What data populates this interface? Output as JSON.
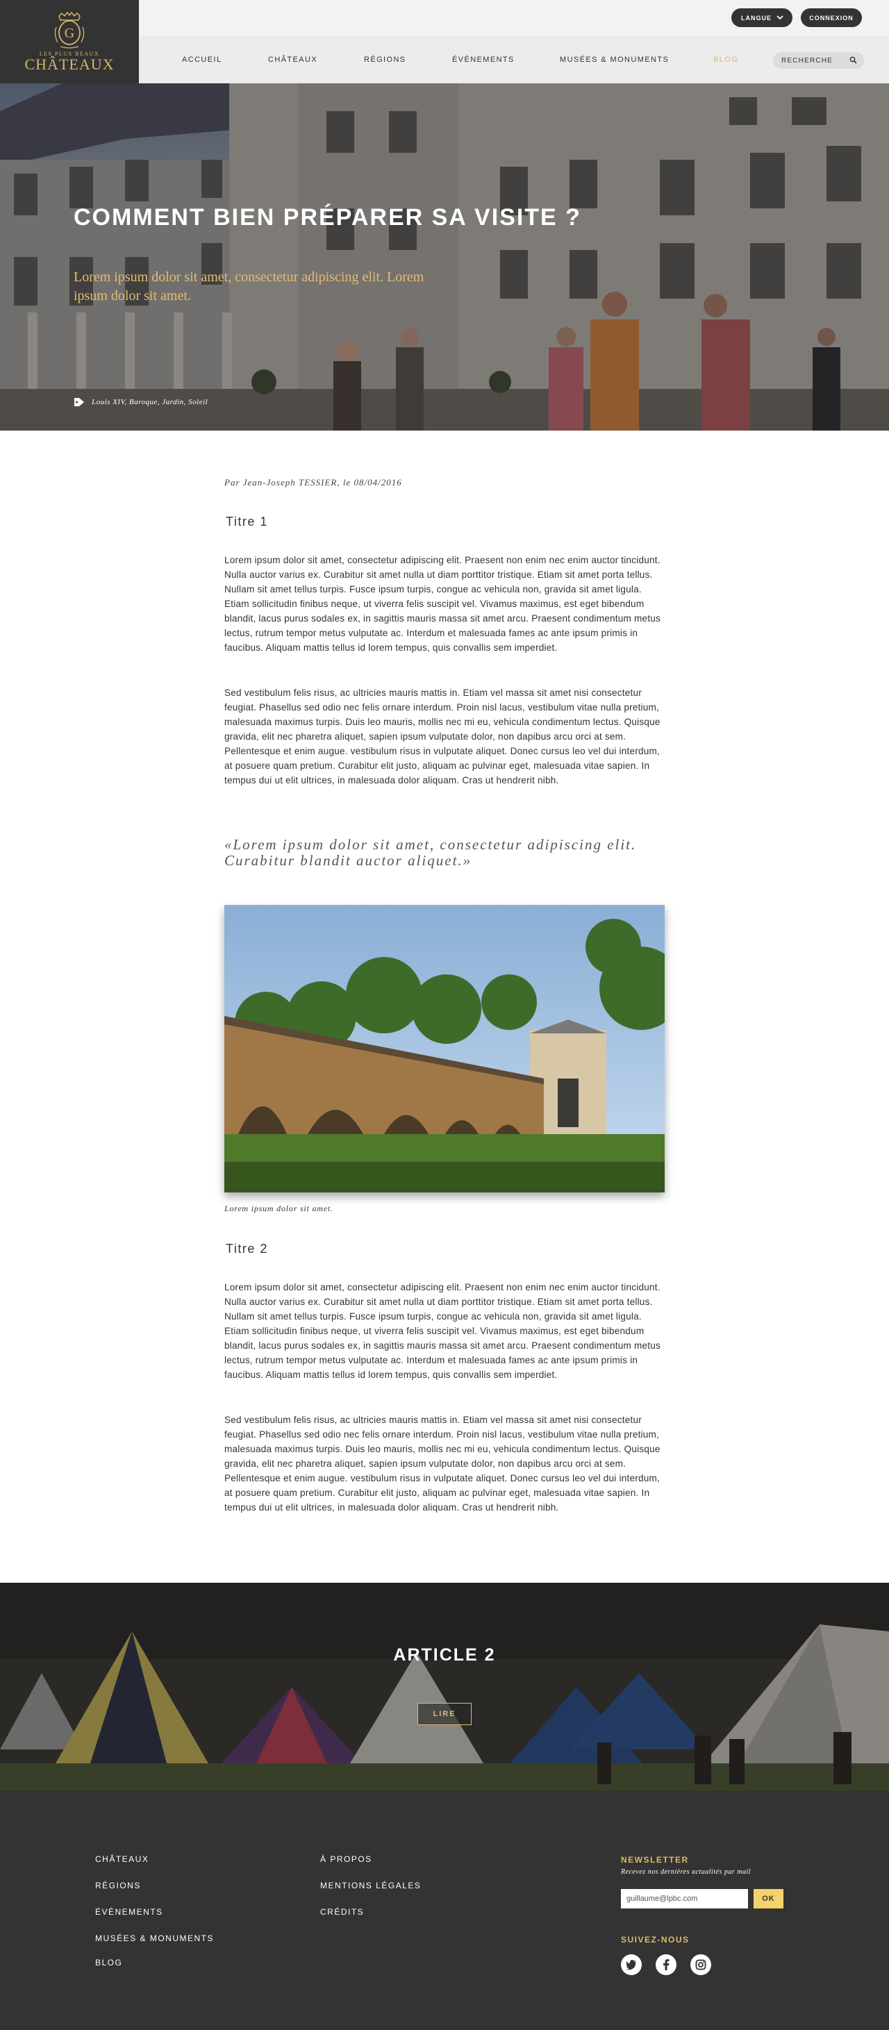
{
  "brand": {
    "logo_small": "LES PLUS BEAUX",
    "logo_big": "CHÂTEAUX",
    "gold": "#e0b96a",
    "dark": "#333333"
  },
  "topbar": {
    "language_label": "LANGUE",
    "login_label": "CONNEXION"
  },
  "nav": {
    "items": [
      "ACCUEIL",
      "CHÂTEAUX",
      "RÉGIONS",
      "ÉVÉNEMENTS",
      "MUSÉES & MONUMENTS",
      "BLOG"
    ],
    "search_label": "RECHERCHE"
  },
  "hero": {
    "title": "COMMENT BIEN PRÉPARER SA VISITE ?",
    "subtitle": "Lorem ipsum dolor sit amet, consectetur adipiscing elit. Lorem ipsum dolor sit amet.",
    "tags": "Louis XIV, Baroque, Jardin, Soleil"
  },
  "article": {
    "byline": "Par Jean-Joseph TESSIER, le 08/04/2016",
    "heading1": "Titre 1",
    "p1": "Lorem ipsum dolor sit amet, consectetur adipiscing elit. Praesent non enim nec enim auctor tincidunt. Nulla auctor varius ex. Curabitur sit amet nulla ut diam porttitor tristique. Etiam sit amet porta tellus. Nullam sit amet tellus turpis. Fusce ipsum turpis, congue ac vehicula non, gravida sit amet ligula. Etiam sollicitudin finibus neque, ut viverra felis suscipit vel. Vivamus maximus, est eget bibendum blandit, lacus purus sodales ex, in sagittis mauris massa sit amet arcu. Praesent condimentum metus lectus, rutrum tempor metus vulputate ac. Interdum et malesuada fames ac ante ipsum primis in faucibus. Aliquam mattis tellus id lorem tempus, quis convallis sem imperdiet.",
    "p2": "Sed vestibulum felis risus, ac ultricies mauris mattis in. Etiam vel massa sit amet nisi consectetur feugiat. Phasellus sed odio nec felis ornare interdum. Proin nisl lacus, vestibulum vitae nulla pretium, malesuada maximus turpis. Duis leo mauris, mollis nec mi eu, vehicula condimentum lectus. Quisque gravida, elit nec pharetra aliquet, sapien ipsum vulputate dolor, non dapibus arcu orci at sem. Pellentesque et enim augue. vestibulum risus in vulputate aliquet. Donec cursus leo vel dui interdum, at posuere quam pretium. Curabitur elit justo, aliquam ac pulvinar eget, malesuada vitae sapien. In tempus dui ut elit ultrices, in malesuada dolor aliquam. Cras ut hendrerit nibh.",
    "quote": "«Lorem ipsum dolor sit amet, consectetur adipiscing elit. Curabitur blandit auctor aliquet.»",
    "caption": "Lorem ipsum dolor sit amet.",
    "heading2": "Titre 2",
    "p3": "Lorem ipsum dolor sit amet, consectetur adipiscing elit. Praesent non enim nec enim auctor tincidunt. Nulla auctor varius ex. Curabitur sit amet nulla ut diam porttitor tristique. Etiam sit amet porta tellus. Nullam sit amet tellus turpis. Fusce ipsum turpis, congue ac vehicula non, gravida sit amet ligula. Etiam sollicitudin finibus neque, ut viverra felis suscipit vel. Vivamus maximus, est eget bibendum blandit, lacus purus sodales ex, in sagittis mauris massa sit amet arcu. Praesent condimentum metus lectus, rutrum tempor metus vulputate ac. Interdum et malesuada fames ac ante ipsum primis in faucibus. Aliquam mattis tellus id lorem tempus, quis convallis sem imperdiet.",
    "p4": "Sed vestibulum felis risus, ac ultricies mauris mattis in. Etiam vel massa sit amet nisi consectetur feugiat. Phasellus sed odio nec felis ornare interdum. Proin nisl lacus, vestibulum vitae nulla pretium, malesuada maximus turpis. Duis leo mauris, mollis nec mi eu, vehicula condimentum lectus. Quisque gravida, elit nec pharetra aliquet, sapien ipsum vulputate dolor, non dapibus arcu orci at sem. Pellentesque et enim augue. vestibulum risus in vulputate aliquet. Donec cursus leo vel dui interdum, at posuere quam pretium. Curabitur elit justo, aliquam ac pulvinar eget, malesuada vitae sapien. In tempus dui ut elit ultrices, in malesuada dolor aliquam. Cras ut hendrerit nibh."
  },
  "next_article": {
    "title": "ARTICLE 2",
    "button_label": "LIRE"
  },
  "footer": {
    "col1": [
      "CHÂTEAUX",
      "RÉGIONS",
      "ÉVÉNEMENTS",
      "MUSÉES & MONUMENTS",
      "BLOG"
    ],
    "col2": [
      "À PROPOS",
      "MENTIONS LÉGALES",
      "CRÉDITS"
    ],
    "newsletter_title": "NEWSLETTER",
    "newsletter_sub": "Recevez nos dernières actualités par mail",
    "newsletter_value": "guillaume@lpbc.com",
    "newsletter_button": "OK",
    "follow_title": "SUIVEZ-NOUS",
    "social_icons": [
      "twitter-icon",
      "facebook-icon",
      "instagram-icon"
    ]
  }
}
